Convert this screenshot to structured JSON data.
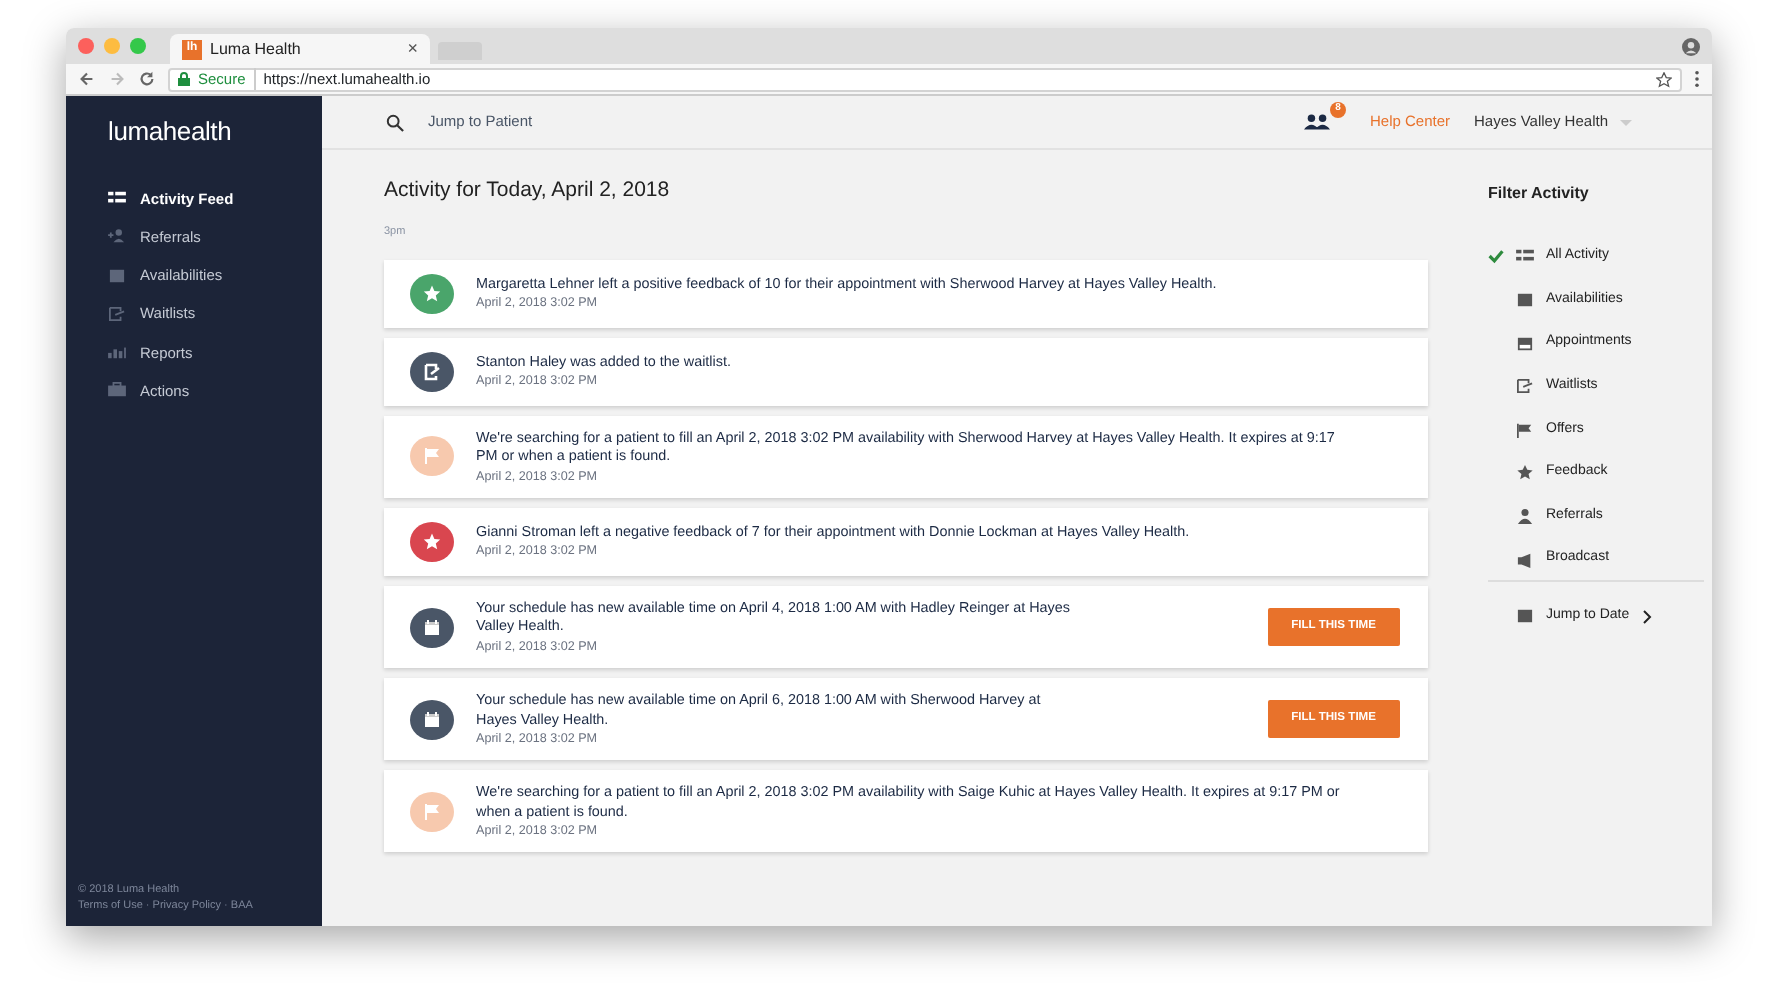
{
  "browser": {
    "tab_title": "Luma Health",
    "tab_favicon": "lh",
    "close_glyph": "×",
    "secure_label": "Secure",
    "url": "https://next.lumahealth.io"
  },
  "sidebar": {
    "logo": "**luma**health",
    "items": [
      {
        "label": "Activity Feed",
        "selected": true
      },
      {
        "label": "Referrals",
        "selected": false
      },
      {
        "label": "Availabilities",
        "selected": false
      },
      {
        "label": "Waitlists",
        "selected": false
      },
      {
        "label": "Reports",
        "selected": false
      },
      {
        "label": "Actions",
        "selected": false
      }
    ],
    "copyright": "© 2018 Luma Health",
    "separator": "·",
    "links": [
      "Terms of Use",
      "Privacy Policy",
      "BAA"
    ]
  },
  "header": {
    "search_placeholder": "Jump to Patient",
    "notification_count": "8",
    "help": "Help Center",
    "organization": "Hayes Valley Health"
  },
  "feed": {
    "title": "Activity for Today, April 2, 2018",
    "time_group": "3pm",
    "items": [
      {
        "kind": "feedback",
        "color": "#4aa56b",
        "text": "Margaretta Lehner left a positive feedback of 10 for their appointment with Sherwood Harvey at Hayes Valley Health.",
        "time": "April 2, 2018 3:02 PM"
      },
      {
        "kind": "waitlist",
        "color": "#4a5667",
        "text": "Stanton Haley was added to the waitlist.",
        "time": "April 2, 2018 3:02 PM"
      },
      {
        "kind": "offer",
        "color": "#f7c9ae",
        "text": "We're searching for a patient to fill an April 2, 2018 3:02 PM availability with Sherwood Harvey at Hayes Valley Health. It expires at 9:17 PM or when a patient is found.",
        "time": "April 2, 2018 3:02 PM"
      },
      {
        "kind": "feedback",
        "color": "#d9464f",
        "text": "Gianni Stroman left a negative feedback of 7 for their appointment with Donnie Lockman at Hayes Valley Health.",
        "time": "April 2, 2018 3:02 PM"
      },
      {
        "kind": "availability",
        "color": "#4a5667",
        "text": "Your schedule has new available time on April 4, 2018 1:00 AM with Hadley Reinger at Hayes Valley Health.",
        "time": "April 2, 2018 3:02 PM",
        "button": "FILL THIS TIME"
      },
      {
        "kind": "availability",
        "color": "#4a5667",
        "text": "Your schedule has new available time on April 6, 2018 1:00 AM with Sherwood Harvey at Hayes Valley Health.",
        "time": "April 2, 2018 3:02 PM",
        "button": "FILL THIS TIME"
      },
      {
        "kind": "offer",
        "color": "#f7c9ae",
        "text": "We're searching for a patient to fill an April 2, 2018 3:02 PM availability with Saige Kuhic at Hayes Valley Health. It expires at 9:17 PM or when a patient is found.",
        "time": "April 2, 2018 3:02 PM"
      }
    ]
  },
  "filter": {
    "title": "Filter Activity",
    "items": [
      {
        "label": "All Activity",
        "checked": true
      },
      {
        "label": "Availabilities",
        "checked": false
      },
      {
        "label": "Appointments",
        "checked": false
      },
      {
        "label": "Waitlists",
        "checked": false
      },
      {
        "label": "Offers",
        "checked": false
      },
      {
        "label": "Feedback",
        "checked": false
      },
      {
        "label": "Referrals",
        "checked": false
      },
      {
        "label": "Broadcast",
        "checked": false
      }
    ],
    "jump": "Jump to Date"
  }
}
